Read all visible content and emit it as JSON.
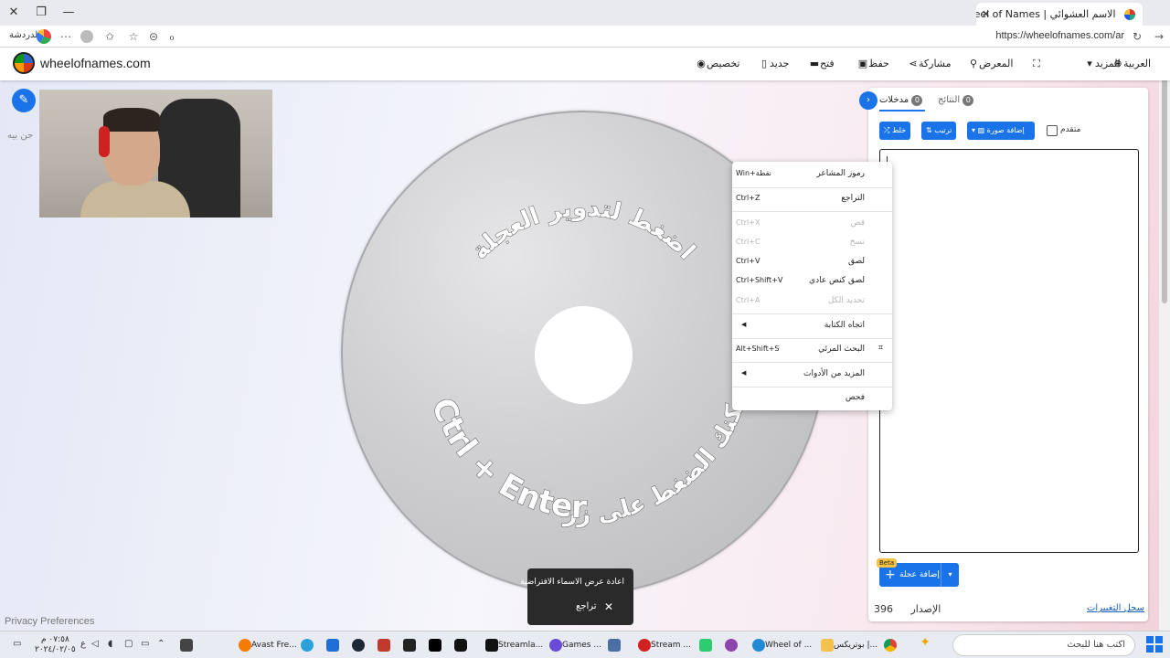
{
  "browser": {
    "tab_title": "الاسم العشوائي | Wheel of Names",
    "url": "https://wheelofnames.com/ar",
    "profile_label": "الدردشة",
    "new_tab": "+",
    "close": "✕"
  },
  "header": {
    "brand": "wheelofnames.com",
    "nav": {
      "customize": "تخصيص",
      "new": "جديد",
      "open": "فتح",
      "save": "حفظ",
      "share": "مشاركة",
      "gallery": "المعرض",
      "more": "المزيد",
      "language": "العربية"
    }
  },
  "main": {
    "side_text": "حن بيه",
    "privacy": "Privacy Preferences",
    "wheel": {
      "line_top": "اضغط لتدوير العجلة",
      "line_bottom_ar": "يمكنك الضغط على زر",
      "line_bottom_en": "Ctrl + Enter"
    },
    "toast": {
      "message": "اعادة عرض الاسماء الافتراضية",
      "undo": "تراجع",
      "close": "✕"
    }
  },
  "panel": {
    "tab_entries": "مدخلات",
    "tab_entries_count": "0",
    "tab_results": "النتائج",
    "tab_results_count": "0",
    "shuffle": "خلط",
    "sort": "ترتيب",
    "add_image": "إضافة صورة",
    "advanced": "متقدم",
    "add_wheel": "إضافة عجلة",
    "beta": "Beta",
    "version_label": "الإصدار",
    "version_number": "396",
    "changelog": "سجل التغييرات"
  },
  "context_menu": {
    "items": [
      {
        "label": "رموز المشاعر",
        "key": "Win+نقطة",
        "disabled": false
      },
      {
        "label": "التراجع",
        "key": "Ctrl+Z",
        "disabled": false
      },
      {
        "label": "قص",
        "key": "Ctrl+X",
        "disabled": true
      },
      {
        "label": "نسخ",
        "key": "Ctrl+C",
        "disabled": true
      },
      {
        "label": "لصق",
        "key": "Ctrl+V",
        "disabled": false
      },
      {
        "label": "لصق كنص عادي",
        "key": "Ctrl+Shift+V",
        "disabled": false
      },
      {
        "label": "تحديد الكل",
        "key": "Ctrl+A",
        "disabled": true
      },
      {
        "label": "اتجاه الكتابة",
        "key": "",
        "disabled": false
      },
      {
        "label": "البحث المرئي",
        "key": "Alt+Shift+S",
        "disabled": false
      },
      {
        "label": "المزيد من الأدوات",
        "key": "",
        "disabled": false
      },
      {
        "label": "فحص",
        "key": "",
        "disabled": false
      }
    ]
  },
  "taskbar": {
    "search": "اكتب هنا للبحث",
    "apps": {
      "app1": "بوتريكس |...",
      "app2": "Wheel of ...",
      "app3": "Stream ...",
      "app4": "Games ...",
      "app5": "Streamla...",
      "app6": "Avast Fre..."
    },
    "time": "٠٧:٥٨ م",
    "date": "٢٠٢٤/٠٢/٠٥",
    "lang": "ع"
  }
}
